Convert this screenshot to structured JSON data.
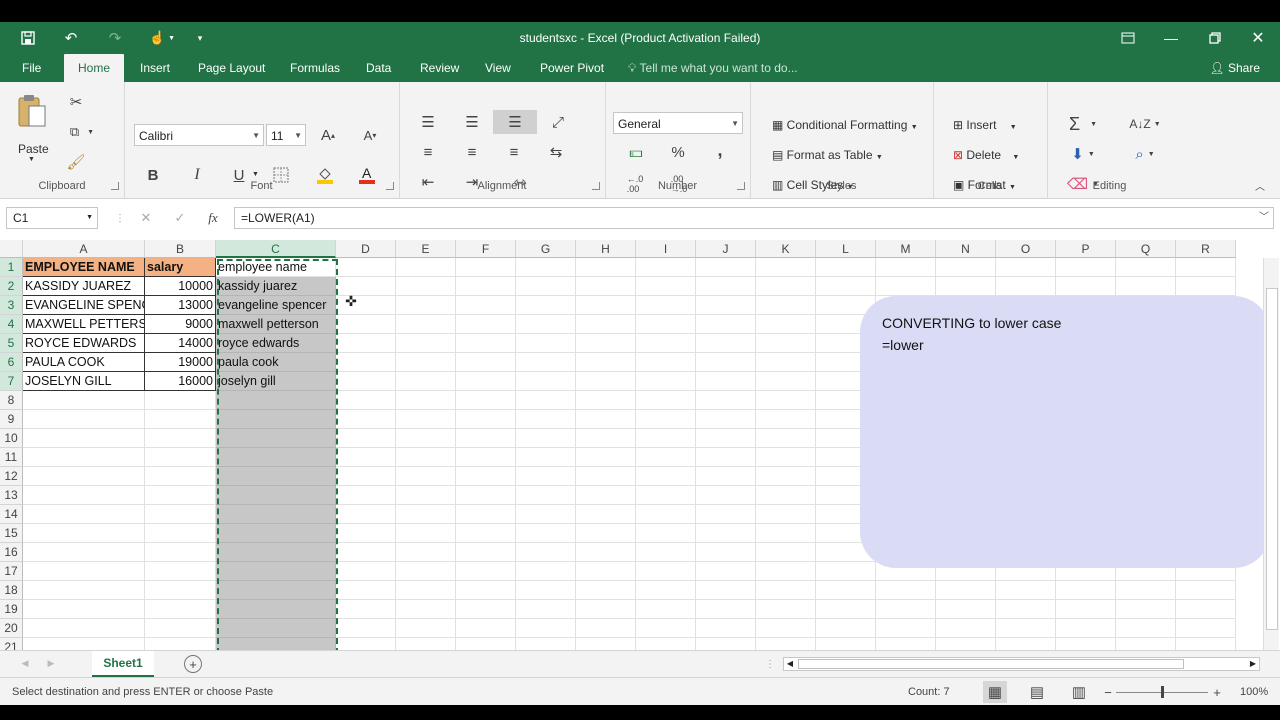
{
  "window": {
    "title": "studentsxc - Excel (Product Activation Failed)",
    "minimize_icon": "minimize-icon",
    "restore_icon": "restore-icon",
    "close_icon": "close-icon"
  },
  "tabs": [
    "File",
    "Home",
    "Insert",
    "Page Layout",
    "Formulas",
    "Data",
    "Review",
    "View",
    "Power Pivot"
  ],
  "active_tab": "Home",
  "tell_me": "Tell me what you want to do...",
  "share": "Share",
  "ribbon": {
    "clipboard": {
      "label": "Clipboard",
      "paste": "Paste"
    },
    "font": {
      "label": "Font",
      "name": "Calibri",
      "size": "11",
      "bold": "B",
      "italic": "I",
      "underline": "U"
    },
    "alignment": {
      "label": "Alignment"
    },
    "number": {
      "label": "Number",
      "format": "General",
      "percent": "%",
      "comma": ","
    },
    "styles": {
      "label": "Styles",
      "conditional": "Conditional Formatting",
      "format_table": "Format as Table",
      "cell_styles": "Cell Styles"
    },
    "cells": {
      "label": "Cells",
      "insert": "Insert",
      "delete": "Delete",
      "format": "Format"
    },
    "editing": {
      "label": "Editing"
    }
  },
  "formula_bar": {
    "name_box": "C1",
    "fx": "fx",
    "formula": "=LOWER(A1)"
  },
  "columns": [
    "A",
    "B",
    "C",
    "D",
    "E",
    "F",
    "G",
    "H",
    "I",
    "J",
    "K",
    "L",
    "M",
    "N",
    "O",
    "P",
    "Q",
    "R"
  ],
  "rows": [
    "1",
    "2",
    "3",
    "4",
    "5",
    "6",
    "7",
    "8",
    "9",
    "10",
    "11",
    "12",
    "13",
    "14",
    "15",
    "16",
    "17",
    "18",
    "19",
    "20",
    "21"
  ],
  "cells": {
    "A": [
      "EMPLOYEE NAME",
      "KASSIDY JUAREZ",
      "EVANGELINE SPENCER",
      "MAXWELL PETTERSON",
      "ROYCE EDWARDS",
      "PAULA COOK",
      "JOSELYN GILL"
    ],
    "B": [
      "salary",
      "10000",
      "13000",
      "9000",
      "14000",
      "19000",
      "16000"
    ],
    "C": [
      "employee name",
      "kassidy juarez",
      "evangeline spencer",
      "maxwell petterson",
      "royce edwards",
      "paula cook",
      "joselyn gill"
    ]
  },
  "callout": {
    "line1": "CONVERTING to lower case",
    "line2": "=lower"
  },
  "sheet": {
    "name": "Sheet1",
    "add": "+"
  },
  "status": {
    "message": "Select destination and press ENTER or choose Paste",
    "count": "Count: 7",
    "zoom": "100%"
  }
}
